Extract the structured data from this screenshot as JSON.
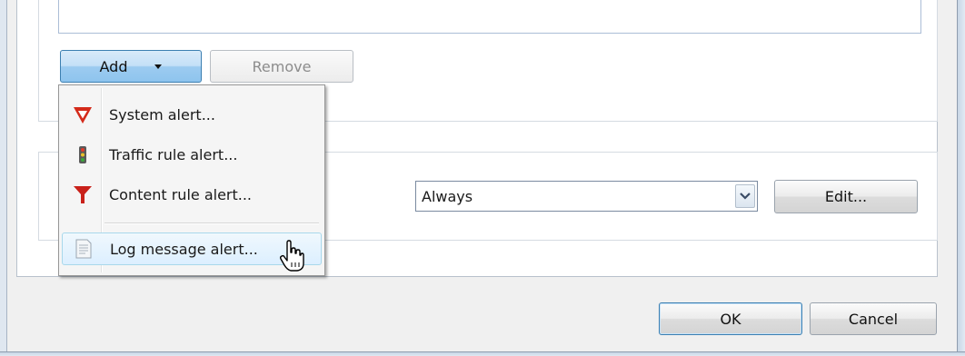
{
  "alerts": {
    "add_label": "Add",
    "remove_label": "Remove"
  },
  "add_menu": {
    "items": [
      {
        "label": "System alert...",
        "icon": "shield-icon"
      },
      {
        "label": "Traffic rule alert...",
        "icon": "traffic-light-icon"
      },
      {
        "label": "Content rule alert...",
        "icon": "funnel-icon"
      },
      {
        "label": "Log message alert...",
        "icon": "document-icon"
      }
    ],
    "highlighted_index": 3
  },
  "schedule": {
    "selected": "Always",
    "edit_label": "Edit..."
  },
  "dialog": {
    "ok_label": "OK",
    "cancel_label": "Cancel"
  },
  "colors": {
    "accent": "#3c7fb1",
    "highlight": "#dcefff",
    "shield_red": "#d42a1a"
  }
}
